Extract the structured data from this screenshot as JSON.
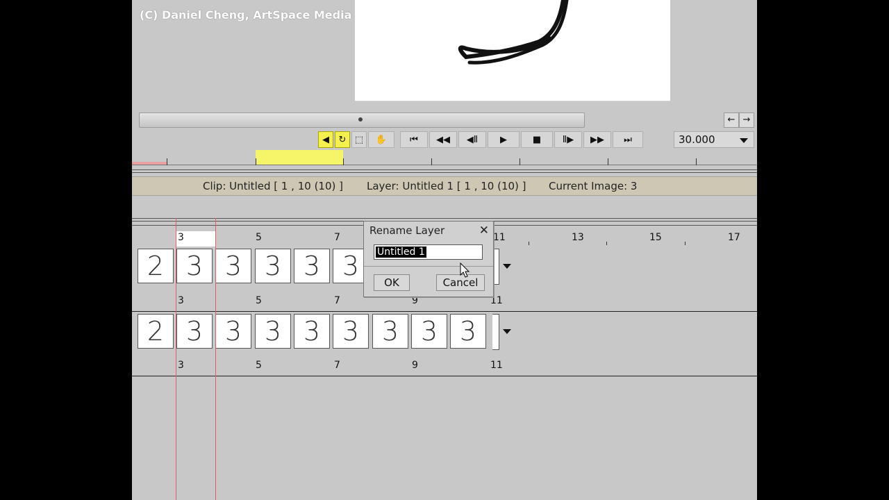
{
  "watermark": "(C) Daniel Cheng, ArtSpace Media",
  "nav": {
    "left_arrow": "←",
    "right_arrow": "→"
  },
  "transport": {
    "buttons": [
      {
        "name": "sound-toggle-button",
        "glyph": "◀",
        "active": true
      },
      {
        "name": "loop-toggle-button",
        "glyph": "↻",
        "active": true
      },
      {
        "name": "selection-frame-button",
        "glyph": "⬚",
        "active": false
      },
      {
        "name": "hand-tool-button",
        "glyph": "✋",
        "active": false
      },
      {
        "name": "go-to-start-button",
        "glyph": "⏮"
      },
      {
        "name": "rewind-button",
        "glyph": "◀◀"
      },
      {
        "name": "step-back-button",
        "glyph": "◀Ⅱ"
      },
      {
        "name": "play-button",
        "glyph": "▶"
      },
      {
        "name": "stop-button",
        "glyph": "■"
      },
      {
        "name": "step-forward-button",
        "glyph": "Ⅱ▶"
      },
      {
        "name": "fast-forward-button",
        "glyph": "▶▶"
      },
      {
        "name": "go-to-end-button",
        "glyph": "⏭"
      }
    ],
    "fps": "30.000"
  },
  "status": {
    "clip": "Clip: Untitled [ 1 , 10  (10) ]",
    "layer": "Layer: Untitled 1 [ 1 , 10  (10) ]",
    "current_image": "Current Image: 3"
  },
  "ruler_numbers": [
    "3",
    "5",
    "7",
    "9",
    "11",
    "13",
    "15",
    "17"
  ],
  "track1": {
    "frames": [
      "2",
      "3",
      "3",
      "3",
      "3",
      "3"
    ],
    "labels": [
      "3",
      "5",
      "7",
      "9",
      "11"
    ]
  },
  "track2": {
    "frames": [
      "2",
      "3",
      "3",
      "3",
      "3",
      "3",
      "3",
      "3",
      "3"
    ],
    "labels": [
      "3",
      "5",
      "7",
      "9",
      "11"
    ]
  },
  "dialog": {
    "title": "Rename Layer",
    "close": "✕",
    "input_value": "Untitled 1",
    "ok": "OK",
    "cancel": "Cancel"
  },
  "colors": {
    "active": "#f4f04e",
    "status_bar": "#cdc7b3",
    "playhead": "#e06060"
  }
}
